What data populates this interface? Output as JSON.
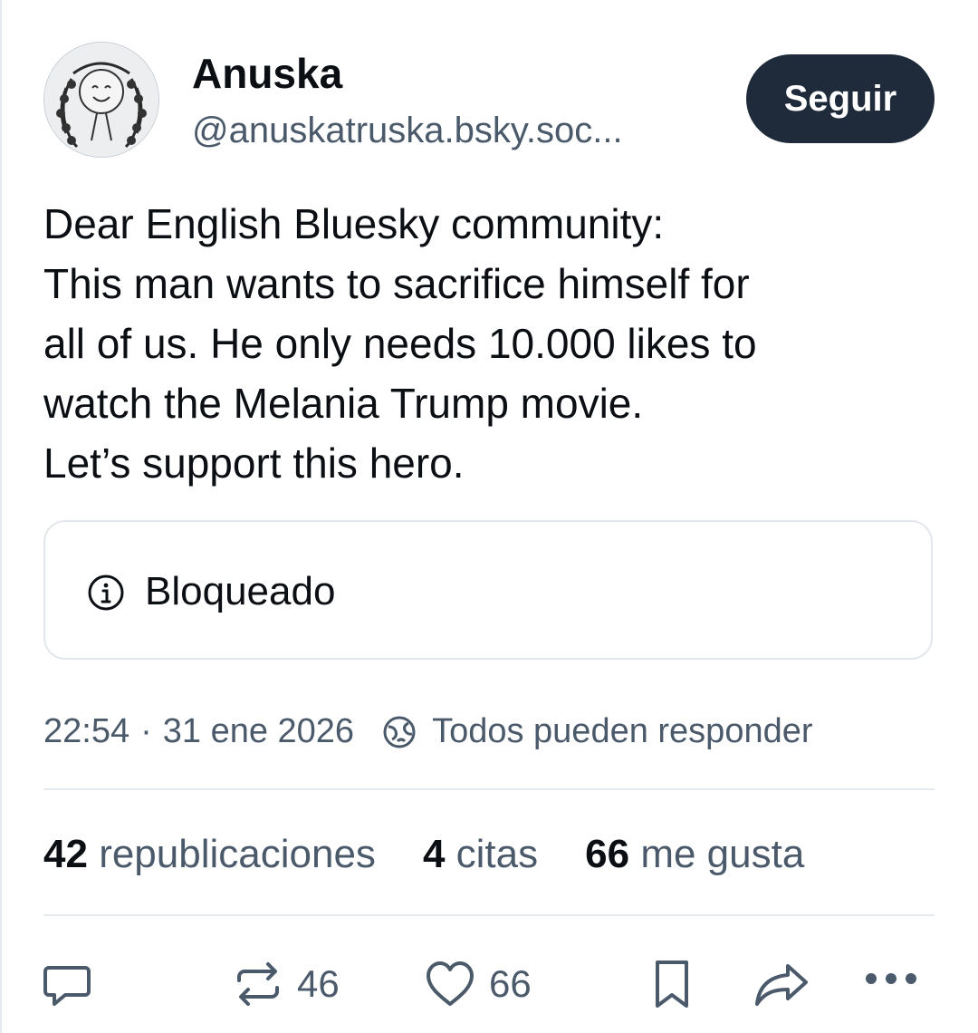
{
  "author": {
    "name": "Anuska",
    "handle": "@anuskatruska.bsky.soc...",
    "follow_label": "Seguir"
  },
  "post": {
    "lines": [
      "Dear English Bluesky community:",
      "This man wants to sacrifice himself for",
      "all of us. He only needs 10.000 likes to",
      "watch the Melania Trump movie.",
      "Let’s support this hero."
    ],
    "embed": {
      "icon": "info-icon",
      "label": "Bloqueado"
    },
    "time": "22:54",
    "separator": "·",
    "date": "31 ene 2026",
    "reply_setting_icon": "globe-icon",
    "reply_setting": "Todos pueden responder"
  },
  "stats": {
    "reposts": {
      "count": "42",
      "label": "republicaciones"
    },
    "quotes": {
      "count": "4",
      "label": "citas"
    },
    "likes": {
      "count": "66",
      "label": "me gusta"
    }
  },
  "actions": {
    "reply": {
      "icon": "reply-icon",
      "count": ""
    },
    "repost": {
      "icon": "repost-icon",
      "count": "46"
    },
    "like": {
      "icon": "heart-icon",
      "count": "66"
    },
    "bookmark": {
      "icon": "bookmark-icon"
    },
    "share": {
      "icon": "share-icon"
    },
    "more": {
      "icon": "more-icon"
    }
  },
  "colors": {
    "primary_text": "#0b0f14",
    "secondary_text": "#4b5a6b",
    "follow_button": "#1f2b3b",
    "border": "#e3e7ec"
  }
}
